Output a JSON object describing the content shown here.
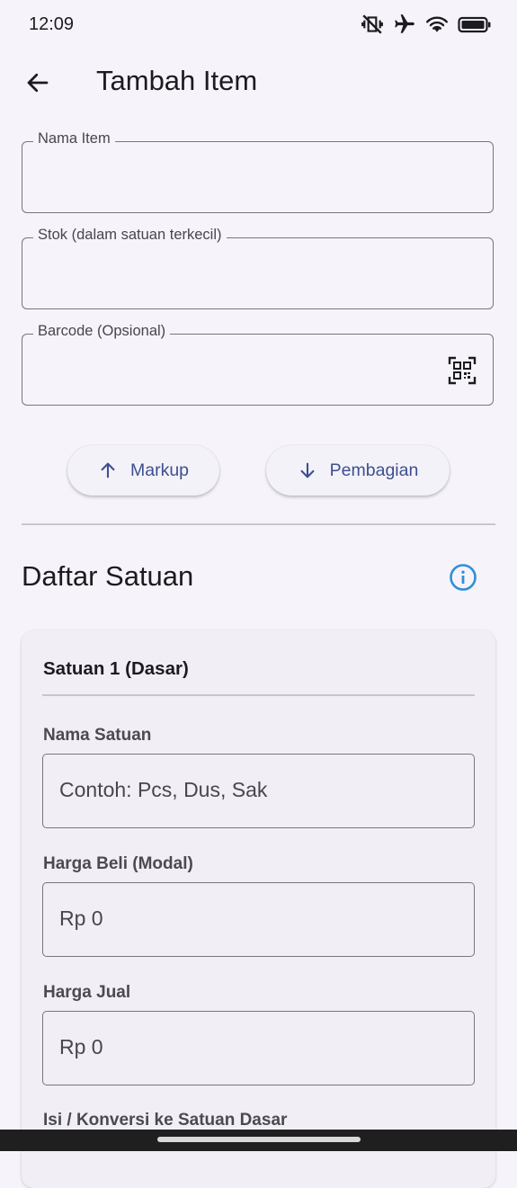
{
  "status_bar": {
    "time": "12:09",
    "icons": [
      "vibrate-off-icon",
      "airplane-icon",
      "wifi-icon",
      "battery-icon"
    ]
  },
  "app_bar": {
    "back_icon": "arrow-left-icon",
    "title": "Tambah Item"
  },
  "form": {
    "item_name": {
      "label": "Nama Item",
      "value": ""
    },
    "stock": {
      "label": "Stok (dalam satuan terkecil)",
      "value": ""
    },
    "barcode": {
      "label": "Barcode (Opsional)",
      "value": "",
      "action_icon": "qr-scan-icon"
    }
  },
  "actions": {
    "markup": {
      "label": "Markup",
      "icon": "arrow-up-icon"
    },
    "division": {
      "label": "Pembagian",
      "icon": "arrow-down-icon"
    }
  },
  "units_section": {
    "title": "Daftar Satuan",
    "info_icon": "info-icon",
    "card": {
      "title": "Satuan 1 (Dasar)",
      "unit_name": {
        "label": "Nama Satuan",
        "placeholder": "Contoh: Pcs, Dus, Sak"
      },
      "buy_price": {
        "label": "Harga Beli (Modal)",
        "placeholder": "Rp 0"
      },
      "sell_price": {
        "label": "Harga Jual",
        "placeholder": "Rp 0"
      },
      "conversion": {
        "label": "Isi / Konversi ke Satuan Dasar"
      }
    }
  },
  "colors": {
    "accent": "#3d4f8f",
    "info_icon": "#2f8fd8",
    "background": "#f6f4fa",
    "outline": "#79747e"
  }
}
